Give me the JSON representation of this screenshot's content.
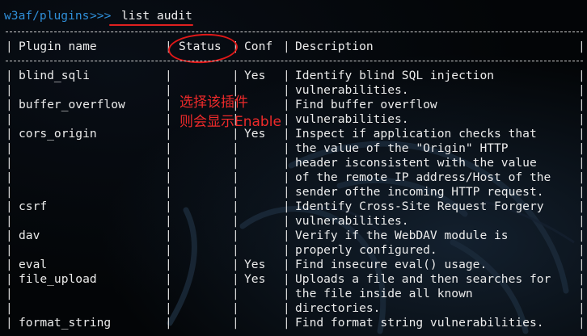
{
  "prompt": {
    "path": "w3af/plugins",
    "marker": ">>> ",
    "command": "list audit"
  },
  "table": {
    "headers": {
      "plugin": "Plugin name",
      "status": "Status",
      "conf": "Conf",
      "description": "Description"
    },
    "rows": [
      {
        "plugin": "blind_sqli",
        "status": "",
        "conf": "Yes",
        "description": [
          "Identify blind SQL injection",
          "vulnerabilities."
        ]
      },
      {
        "plugin": "buffer_overflow",
        "status": "",
        "conf": "",
        "description": [
          "Find buffer overflow",
          "vulnerabilities."
        ]
      },
      {
        "plugin": "cors_origin",
        "status": "",
        "conf": "Yes",
        "description": [
          "Inspect if application checks that",
          "the value of the \"Origin\" HTTP",
          "header isconsistent with the value",
          "of the remote IP address/Host of the",
          "sender ofthe incoming HTTP request."
        ]
      },
      {
        "plugin": "csrf",
        "status": "",
        "conf": "",
        "description": [
          "Identify Cross-Site Request Forgery",
          "vulnerabilities."
        ]
      },
      {
        "plugin": "dav",
        "status": "",
        "conf": "",
        "description": [
          "Verify if the WebDAV module is",
          "properly configured."
        ]
      },
      {
        "plugin": "eval",
        "status": "",
        "conf": "Yes",
        "description": [
          "Find insecure eval() usage."
        ]
      },
      {
        "plugin": "file_upload",
        "status": "",
        "conf": "Yes",
        "description": [
          "Uploads a file and then searches for",
          "the file inside all known",
          "directories."
        ]
      },
      {
        "plugin": "format_string",
        "status": "",
        "conf": "",
        "description": [
          "Find format string vulnerabilities."
        ]
      }
    ]
  },
  "annotation": {
    "line1": "选择该插件",
    "line2": "则会显示Enable"
  },
  "colors": {
    "prompt": "#2f8fd9",
    "annotation": "#ee2a2a",
    "background": "#030507",
    "text": "#ececec"
  }
}
